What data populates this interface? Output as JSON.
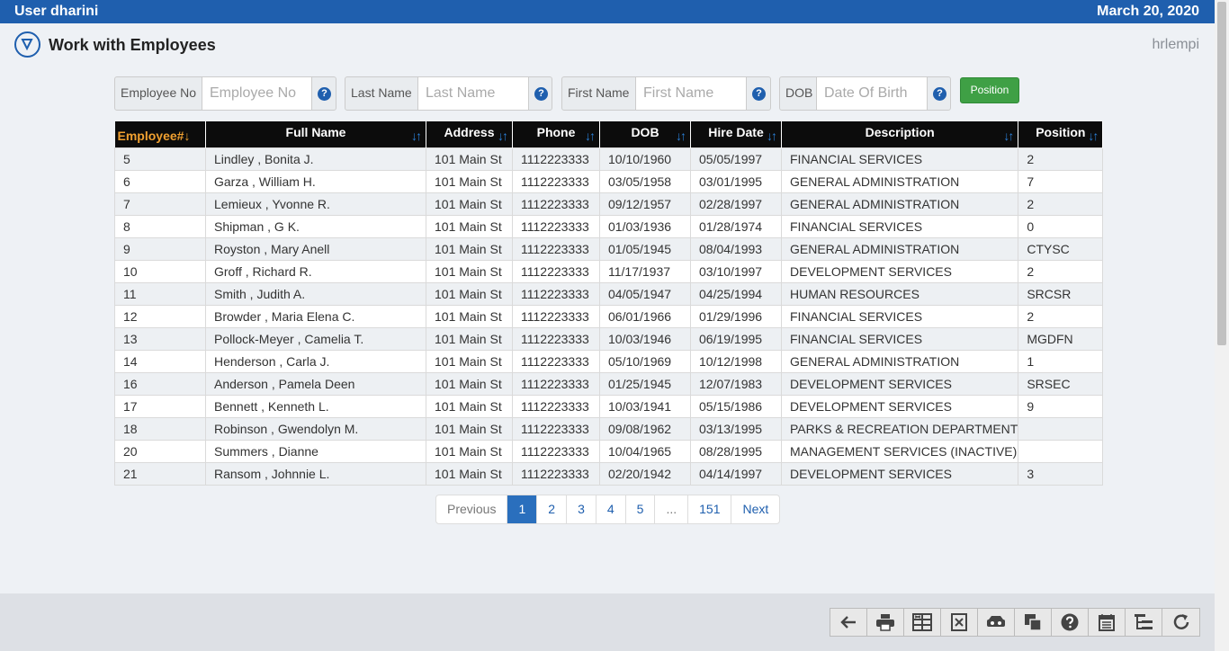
{
  "header": {
    "user": "User dharini",
    "date": "March 20, 2020"
  },
  "titlebar": {
    "title": "Work with Employees",
    "program": "hrlempi"
  },
  "filters": {
    "employee_no": {
      "label": "Employee No",
      "placeholder": "Employee No"
    },
    "last_name": {
      "label": "Last Name",
      "placeholder": "Last Name"
    },
    "first_name": {
      "label": "First Name",
      "placeholder": "First Name"
    },
    "dob": {
      "label": "DOB",
      "placeholder": "Date Of Birth"
    },
    "help_glyph": "?",
    "position_button": "Position"
  },
  "table": {
    "columns": [
      "Employee#",
      "Full Name",
      "Address",
      "Phone",
      "DOB",
      "Hire Date",
      "Description",
      "Position"
    ],
    "sort_active_glyph": "↓",
    "sort_glyph": "↓↑",
    "rows": [
      [
        "5",
        "Lindley , Bonita J.",
        "101 Main St",
        "1112223333",
        "10/10/1960",
        "05/05/1997",
        "FINANCIAL SERVICES",
        "2"
      ],
      [
        "6",
        "Garza , William H.",
        "101 Main St",
        "1112223333",
        "03/05/1958",
        "03/01/1995",
        "GENERAL ADMINISTRATION",
        "7"
      ],
      [
        "7",
        "Lemieux , Yvonne R.",
        "101 Main St",
        "1112223333",
        "09/12/1957",
        "02/28/1997",
        "GENERAL ADMINISTRATION",
        "2"
      ],
      [
        "8",
        "Shipman , G K.",
        "101 Main St",
        "1112223333",
        "01/03/1936",
        "01/28/1974",
        "FINANCIAL SERVICES",
        "0"
      ],
      [
        "9",
        "Royston , Mary Anell",
        "101 Main St",
        "1112223333",
        "01/05/1945",
        "08/04/1993",
        "GENERAL ADMINISTRATION",
        "CTYSC"
      ],
      [
        "10",
        "Groff , Richard R.",
        "101 Main St",
        "1112223333",
        "11/17/1937",
        "03/10/1997",
        "DEVELOPMENT SERVICES",
        "2"
      ],
      [
        "11",
        "Smith , Judith A.",
        "101 Main St",
        "1112223333",
        "04/05/1947",
        "04/25/1994",
        "HUMAN RESOURCES",
        "SRCSR"
      ],
      [
        "12",
        "Browder , Maria Elena C.",
        "101 Main St",
        "1112223333",
        "06/01/1966",
        "01/29/1996",
        "FINANCIAL SERVICES",
        "2"
      ],
      [
        "13",
        "Pollock-Meyer , Camelia T.",
        "101 Main St",
        "1112223333",
        "10/03/1946",
        "06/19/1995",
        "FINANCIAL SERVICES",
        "MGDFN"
      ],
      [
        "14",
        "Henderson , Carla J.",
        "101 Main St",
        "1112223333",
        "05/10/1969",
        "10/12/1998",
        "GENERAL ADMINISTRATION",
        "1"
      ],
      [
        "16",
        "Anderson , Pamela Deen",
        "101 Main St",
        "1112223333",
        "01/25/1945",
        "12/07/1983",
        "DEVELOPMENT SERVICES",
        "SRSEC"
      ],
      [
        "17",
        "Bennett , Kenneth L.",
        "101 Main St",
        "1112223333",
        "10/03/1941",
        "05/15/1986",
        "DEVELOPMENT SERVICES",
        "9"
      ],
      [
        "18",
        "Robinson , Gwendolyn M.",
        "101 Main St",
        "1112223333",
        "09/08/1962",
        "03/13/1995",
        "PARKS & RECREATION DEPARTMENT",
        ""
      ],
      [
        "20",
        "Summers , Dianne",
        "101 Main St",
        "1112223333",
        "10/04/1965",
        "08/28/1995",
        "MANAGEMENT SERVICES (INACTIVE)",
        ""
      ],
      [
        "21",
        "Ransom , Johnnie L.",
        "101 Main St",
        "1112223333",
        "02/20/1942",
        "04/14/1997",
        "DEVELOPMENT SERVICES",
        "3"
      ]
    ]
  },
  "pagination": {
    "previous": "Previous",
    "pages": [
      "1",
      "2",
      "3",
      "4",
      "5",
      "...",
      "151"
    ],
    "current": "1",
    "next": "Next"
  },
  "toolbar": [
    "back-icon",
    "print-icon",
    "spreadsheet-icon",
    "excel-icon",
    "subfile-icon",
    "copy-windows-icon",
    "help-icon",
    "calendar-icon",
    "hierarchy-icon",
    "refresh-icon"
  ],
  "colors": {
    "brand": "#1f5fae",
    "header_bg": "#0c0c0c",
    "active_sort": "#f0a030",
    "position_button": "#3fa045"
  }
}
